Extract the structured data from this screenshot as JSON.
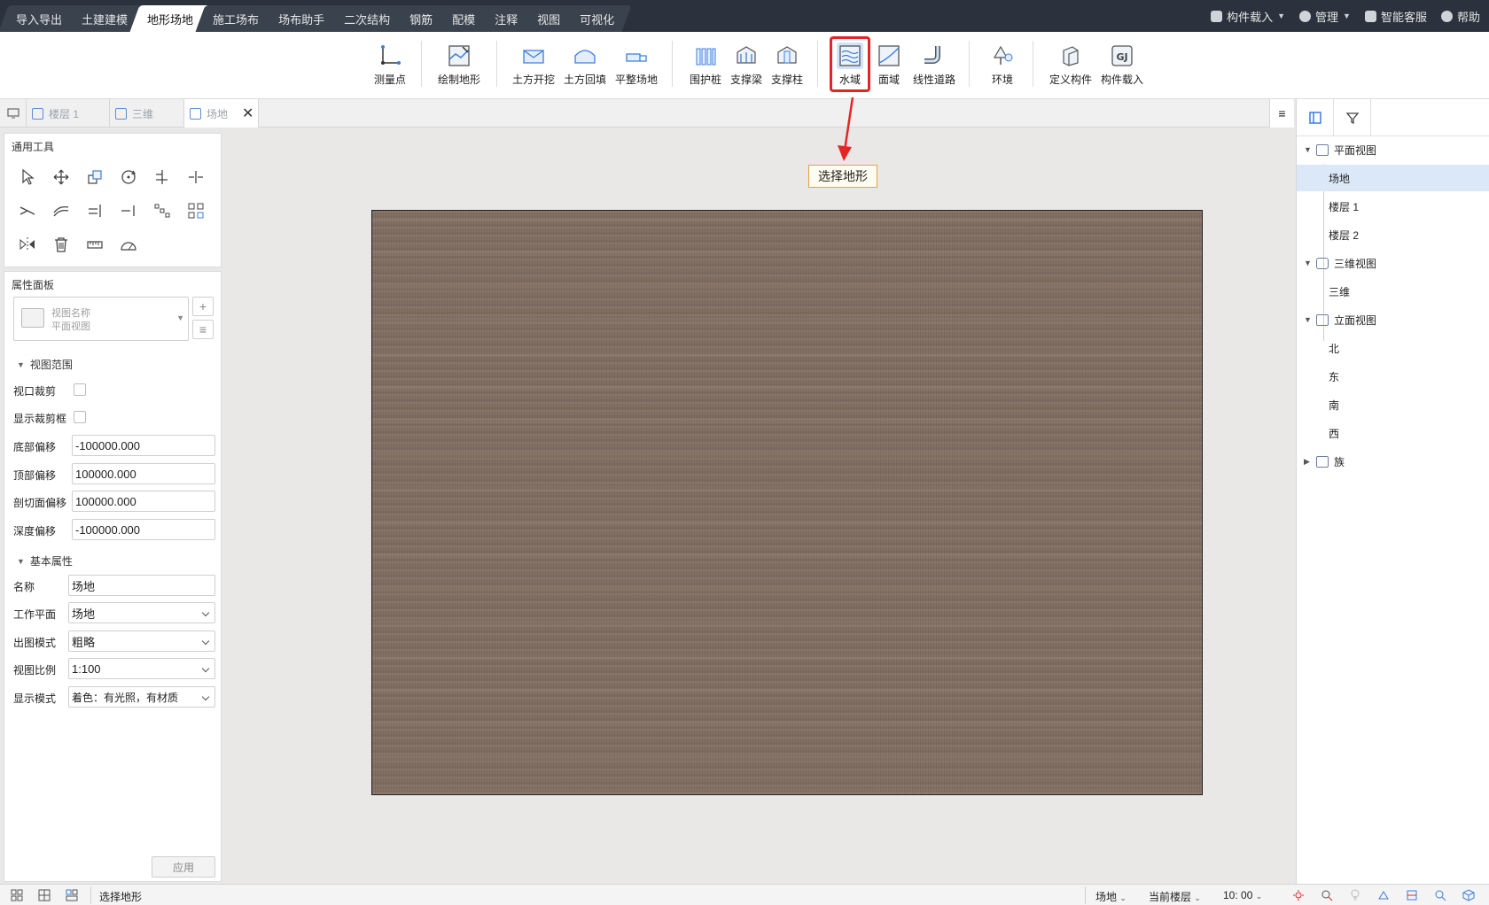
{
  "menu": {
    "tabs": [
      "导入导出",
      "土建建模",
      "地形场地",
      "施工场布",
      "场布助手",
      "二次结构",
      "钢筋",
      "配模",
      "注释",
      "视图",
      "可视化"
    ],
    "active_tab": "地形场地"
  },
  "top_right": {
    "load_component": "构件载入",
    "manage": "管理",
    "smart_service": "智能客服",
    "help": "帮助"
  },
  "ribbon": {
    "measure_point": "测量点",
    "draw_terrain": "绘制地形",
    "earth_excavation": "土方开挖",
    "earth_backfill": "土方回填",
    "level_site": "平整场地",
    "retaining_pile": "围护桩",
    "support_beam": "支撑梁",
    "support_column": "支撑柱",
    "water_area": "水域",
    "surface_area": "面域",
    "linear_road": "线性道路",
    "environment": "环境",
    "define_component": "定义构件",
    "load_component": "构件载入"
  },
  "doc_tabs": {
    "floor1": "楼层 1",
    "view3d": "三维",
    "site": "场地",
    "menu_icon": "≡"
  },
  "general_tools": {
    "title": "通用工具"
  },
  "properties": {
    "title": "属性面板",
    "view_name_label": "视图名称",
    "view_name_value": "平面视图",
    "section_view_range": "视图范围",
    "viewport_crop": "视口裁剪",
    "show_crop_box": "显示裁剪框",
    "bottom_offset_label": "底部偏移",
    "bottom_offset_value": "-100000.000",
    "top_offset_label": "顶部偏移",
    "top_offset_value": "100000.000",
    "cut_plane_offset_label": "剖切面偏移",
    "cut_plane_offset_value": "100000.000",
    "depth_offset_label": "深度偏移",
    "depth_offset_value": "-100000.000",
    "section_basic": "基本属性",
    "name_label": "名称",
    "name_value": "场地",
    "work_plane_label": "工作平面",
    "work_plane_value": "场地",
    "output_mode_label": "出图模式",
    "output_mode_value": "粗略",
    "view_scale_label": "视图比例",
    "view_scale_value": "1:100",
    "display_mode_label": "显示模式",
    "display_mode_value": "着色：有光照，有材质",
    "apply_label": "应用"
  },
  "canvas": {
    "tooltip": "选择地形",
    "terrain_color": "#7e6b60"
  },
  "project_tree": {
    "plan_views": "平面视图",
    "site": "场地",
    "floor1": "楼层 1",
    "floor2": "楼层 2",
    "views_3d": "三维视图",
    "view_3d": "三维",
    "elevation_views": "立面视图",
    "north": "北",
    "east": "东",
    "south": "南",
    "west": "西",
    "families": "族"
  },
  "status": {
    "message": "选择地形",
    "site_select": "场地",
    "current_floor": "当前楼层",
    "time": "10: 00"
  },
  "colors": {
    "accent": "#3c7ddb",
    "highlight": "#e52525",
    "topbar": "#2b323d"
  }
}
